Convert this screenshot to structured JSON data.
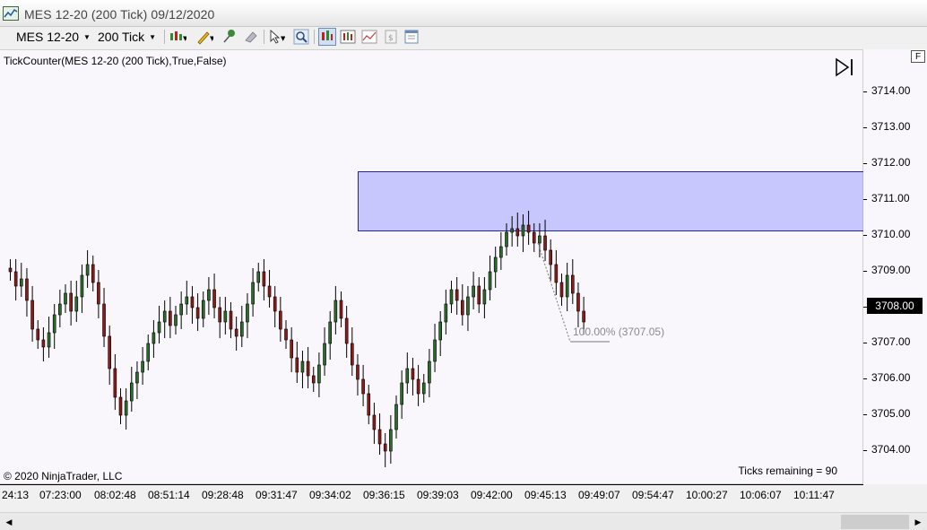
{
  "window": {
    "title": "MES 12-20 (200 Tick)  09/12/2020"
  },
  "toolbar": {
    "instrument": "MES 12-20",
    "interval": "200 Tick",
    "icons": [
      "bar-type-icon",
      "draw-pencil-icon",
      "pin-icon",
      "eraser-icon",
      "pointer-icon",
      "zoom-icon",
      "chart-style-icon",
      "data-box-icon",
      "indicators-icon",
      "strategies-icon",
      "properties-icon"
    ]
  },
  "chart": {
    "indicator_label": "TickCounter(MES 12-20  (200 Tick),True,False)",
    "copyright": "© 2020 NinjaTrader, LLC",
    "ticks_remaining": "Ticks remaining = 90",
    "current_price": "3708.00",
    "fib_label": "100.00%  (3707.05)",
    "zone_color": "#9696ff",
    "up_color": "#2d6b2d",
    "down_color": "#8b1a1a",
    "price_labels": [
      "3714.00",
      "3713.00",
      "3712.00",
      "3711.00",
      "3710.00",
      "3709.00",
      "3708.00",
      "3707.00",
      "3706.00",
      "3705.00",
      "3704.00"
    ],
    "time_labels": [
      "24:13",
      "07:23:00",
      "08:02:48",
      "08:51:14",
      "09:28:48",
      "09:31:47",
      "09:34:02",
      "09:36:15",
      "09:39:03",
      "09:42:00",
      "09:45:13",
      "09:49:07",
      "09:54:47",
      "10:00:27",
      "10:06:07",
      "10:11:47"
    ],
    "f_button": "F"
  },
  "chart_data": {
    "type": "candlestick",
    "instrument": "MES 12-20",
    "interval": "200 Tick",
    "ylim": [
      3703.5,
      3714.5
    ],
    "zone": [
      3710.1,
      3711.8
    ],
    "closes": [
      3709.0,
      3708.6,
      3708.8,
      3708.2,
      3707.4,
      3707.1,
      3706.9,
      3707.3,
      3707.8,
      3708.1,
      3708.4,
      3707.9,
      3708.3,
      3708.9,
      3709.2,
      3708.7,
      3708.1,
      3707.2,
      3706.3,
      3705.5,
      3705.0,
      3705.4,
      3705.9,
      3706.2,
      3706.5,
      3707.0,
      3707.3,
      3707.6,
      3707.9,
      3707.5,
      3707.8,
      3708.1,
      3708.3,
      3708.0,
      3707.7,
      3708.2,
      3708.5,
      3708.0,
      3707.6,
      3707.9,
      3707.4,
      3707.2,
      3707.6,
      3708.1,
      3708.7,
      3709.0,
      3708.6,
      3708.3,
      3707.9,
      3707.4,
      3707.1,
      3706.6,
      3706.2,
      3706.5,
      3706.1,
      3705.9,
      3706.4,
      3707.0,
      3707.6,
      3708.2,
      3707.7,
      3707.0,
      3706.4,
      3706.0,
      3705.6,
      3705.0,
      3704.6,
      3704.2,
      3704.0,
      3704.6,
      3705.3,
      3705.9,
      3706.3,
      3706.0,
      3705.6,
      3705.9,
      3706.5,
      3707.1,
      3707.6,
      3708.1,
      3708.5,
      3708.2,
      3707.8,
      3708.3,
      3708.6,
      3708.1,
      3708.5,
      3709.0,
      3709.4,
      3709.7,
      3710.1,
      3710.2,
      3710.0,
      3710.3,
      3710.1,
      3709.8,
      3710.0,
      3709.6,
      3709.2,
      3708.7,
      3708.3,
      3708.9,
      3708.4,
      3707.9,
      3707.6
    ]
  }
}
